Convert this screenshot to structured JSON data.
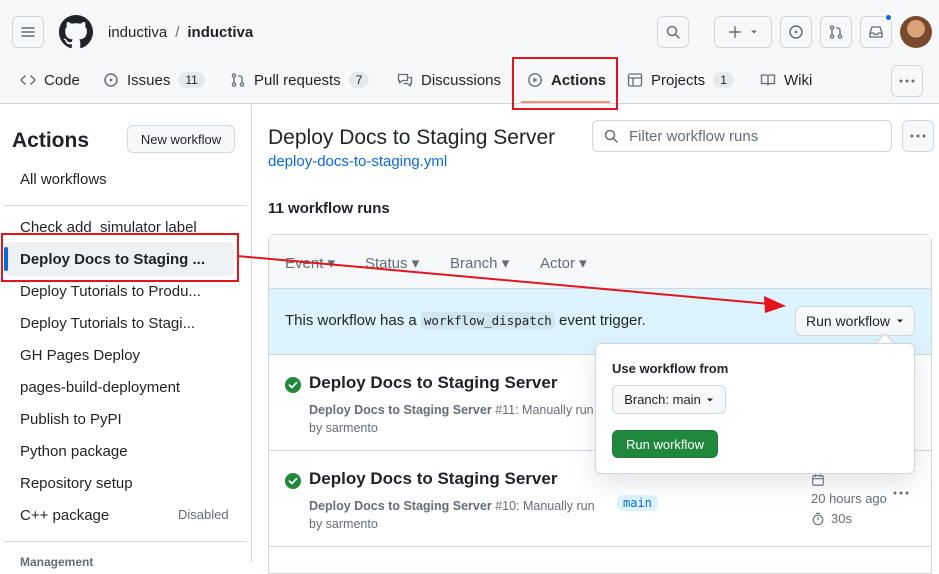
{
  "header": {
    "owner": "inductiva",
    "separator": "/",
    "repo": "inductiva"
  },
  "tabs": [
    {
      "label": "Code",
      "icon": "code-icon"
    },
    {
      "label": "Issues",
      "icon": "issue-icon",
      "count": "11"
    },
    {
      "label": "Pull requests",
      "icon": "pull-request-icon",
      "count": "7"
    },
    {
      "label": "Discussions",
      "icon": "discussion-icon"
    },
    {
      "label": "Actions",
      "icon": "play-icon"
    },
    {
      "label": "Projects",
      "icon": "table-icon",
      "count": "1"
    },
    {
      "label": "Wiki",
      "icon": "book-icon"
    }
  ],
  "sidebar": {
    "title": "Actions",
    "new_workflow": "New workflow",
    "all_workflows": "All workflows",
    "items": [
      "Check add_simulator label",
      "Deploy Docs to Staging ...",
      "Deploy Tutorials to Produ...",
      "Deploy Tutorials to Stagi...",
      "GH Pages Deploy",
      "pages-build-deployment",
      "Publish to PyPI",
      "Python package",
      "Repository setup",
      "C++ package"
    ],
    "disabled_label": "Disabled",
    "management": "Management"
  },
  "main": {
    "title": "Deploy Docs to Staging Server",
    "workflow_file": "deploy-docs-to-staging.yml",
    "filter_placeholder": "Filter workflow runs",
    "runs_count": "11 workflow runs",
    "filters": [
      "Event",
      "Status",
      "Branch",
      "Actor"
    ],
    "dispatch": {
      "text_before": "This workflow has a ",
      "code": "workflow_dispatch",
      "text_after": " event trigger.",
      "button": "Run workflow"
    },
    "runs": [
      {
        "title": "Deploy Docs to Staging Server",
        "workflow": "Deploy Docs to Staging Server",
        "detail": "#11: Manually run",
        "by": "by sarmento"
      },
      {
        "title": "Deploy Docs to Staging Server",
        "workflow": "Deploy Docs to Staging Server",
        "detail": "#10: Manually run",
        "by": "by sarmento",
        "branch": "main",
        "time": "20 hours ago",
        "duration": "30s"
      }
    ]
  },
  "popover": {
    "title": "Use workflow from",
    "branch_button": "Branch: main",
    "run_button": "Run workflow"
  },
  "colors": {
    "accent": "#0969da",
    "success": "#1f883d",
    "annotation": "#e3141b"
  }
}
